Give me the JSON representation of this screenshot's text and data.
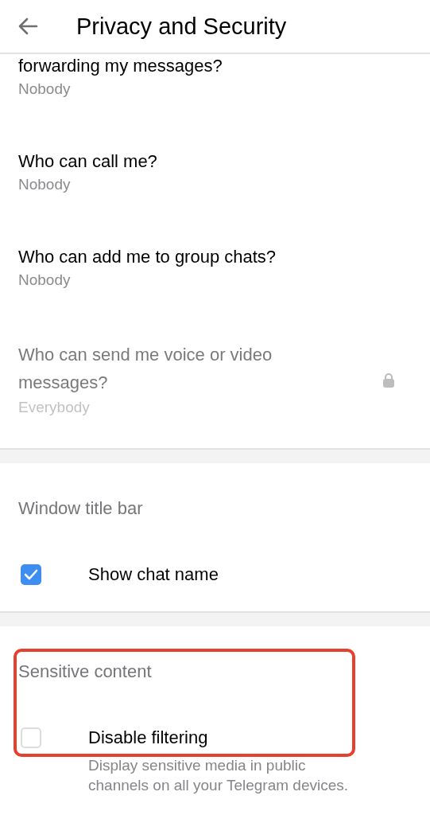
{
  "header": {
    "title": "Privacy and Security"
  },
  "privacy_rows": [
    {
      "title": "forwarding my messages?",
      "value": "Nobody",
      "disabled": false,
      "locked": false
    },
    {
      "title": "Who can call me?",
      "value": "Nobody",
      "disabled": false,
      "locked": false
    },
    {
      "title": "Who can add me to group chats?",
      "value": "Nobody",
      "disabled": false,
      "locked": false
    },
    {
      "title": "Who can send me voice or video messages?",
      "value": "Everybody",
      "disabled": true,
      "locked": true
    }
  ],
  "sections": [
    {
      "heading": "Window title bar",
      "highlighted": false,
      "options": [
        {
          "label": "Show chat name",
          "checked": true
        }
      ]
    },
    {
      "heading": "Sensitive content",
      "highlighted": true,
      "options": [
        {
          "label": "Disable filtering",
          "checked": false,
          "description": "Display sensitive media in public channels on all your Telegram devices."
        }
      ]
    }
  ]
}
